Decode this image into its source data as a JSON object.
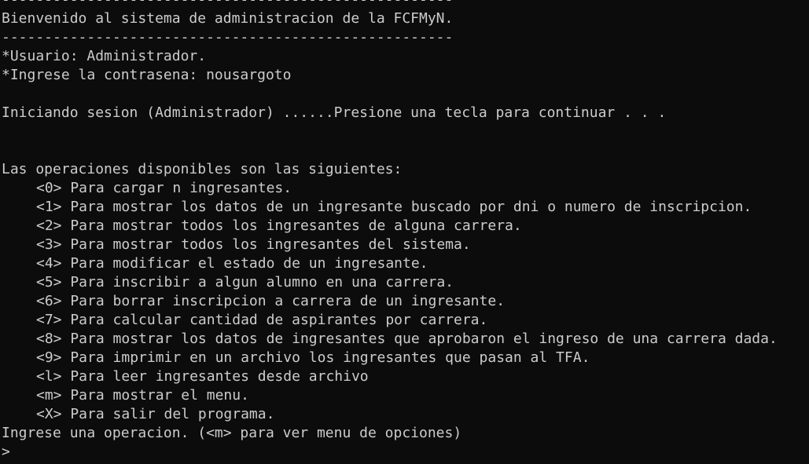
{
  "console": {
    "lines_top": [
      "-----------------------------------------------------",
      "Bienvenido al sistema de administracion de la FCFMyN.",
      "-----------------------------------------------------",
      "*Usuario: Administrador.",
      "*Ingrese la contrasena: nousargoto",
      "",
      "Iniciando sesion (Administrador) ......Presione una tecla para continuar . . .",
      "",
      "",
      "Las operaciones disponibles son las siguientes:"
    ],
    "menu": [
      "<0> Para cargar n ingresantes.",
      "<1> Para mostrar los datos de un ingresante buscado por dni o numero de inscripcion.",
      "<2> Para mostrar todos los ingresantes de alguna carrera.",
      "<3> Para mostrar todos los ingresantes del sistema.",
      "<4> Para modificar el estado de un ingresante.",
      "<5> Para inscribir a algun alumno en una carrera.",
      "<6> Para borrar inscripcion a carrera de un ingresante.",
      "<7> Para calcular cantidad de aspirantes por carrera.",
      "<8> Para mostrar los datos de ingresantes que aprobaron el ingreso de una carrera dada.",
      "<9> Para imprimir en un archivo los ingresantes que pasan al TFA.",
      "<l> Para leer ingresantes desde archivo",
      "<m> Para mostrar el menu.",
      "<X> Para salir del programa."
    ],
    "instruction": "Ingrese una operacion. (<m> para ver menu de opciones)",
    "prompt": ">"
  },
  "colors": {
    "background": "#0c0c0c",
    "text": "#cccccc"
  }
}
